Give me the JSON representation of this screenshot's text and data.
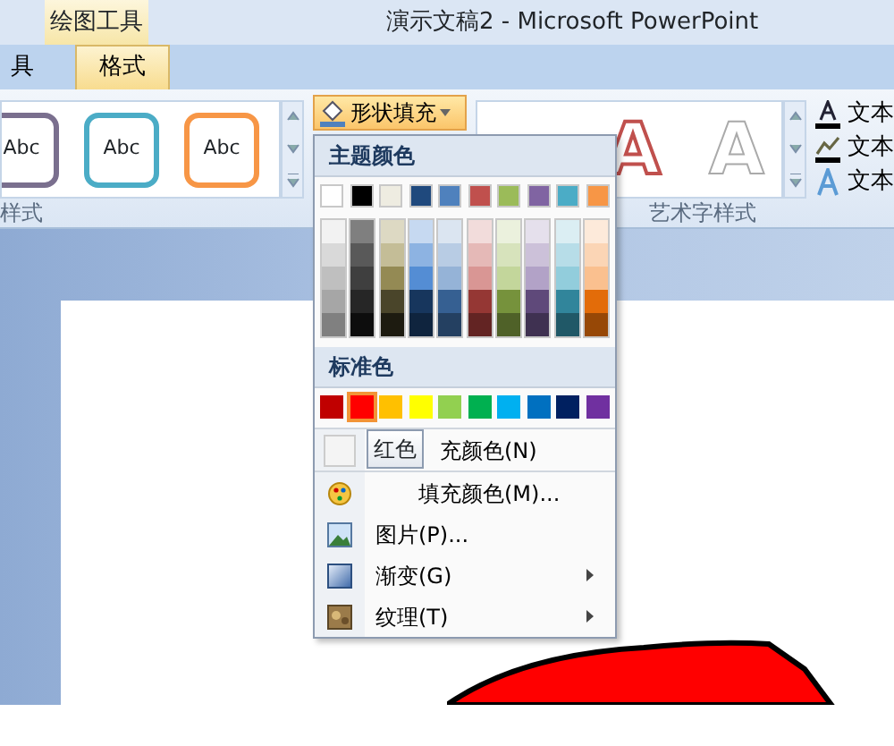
{
  "window": {
    "title": "演示文稿2 - Microsoft PowerPoint",
    "context_tab_group": "绘图工具"
  },
  "tabs": [
    {
      "label": "具",
      "selected": false
    },
    {
      "label": "格式",
      "selected": true
    }
  ],
  "shape_styles": {
    "label": "样式",
    "samples": [
      {
        "text": "Abc",
        "color": "#7a6f8e"
      },
      {
        "text": "Abc",
        "color": "#4bacc6"
      },
      {
        "text": "Abc",
        "color": "#f79646"
      }
    ]
  },
  "shape_fill_button": {
    "label": "形状填充",
    "open": true
  },
  "wordart_styles": {
    "label": "艺术字样式",
    "samples": [
      {
        "kind": "hidden"
      },
      {
        "text": "A",
        "kind": "red-outline"
      },
      {
        "text": "A",
        "kind": "white"
      }
    ],
    "buttons": [
      {
        "label": "文本",
        "kind": "fill"
      },
      {
        "label": "文本",
        "kind": "outline"
      },
      {
        "label": "文本",
        "kind": "effects"
      }
    ]
  },
  "fill_menu": {
    "theme_header": "主题颜色",
    "theme_colors": [
      {
        "shades": [
          {
            "color": "#ffffff"
          },
          {
            "color": "#f2f2f2"
          },
          {
            "color": "#d9d9d9"
          },
          {
            "color": "#bfbfbf"
          },
          {
            "color": "#a6a6a6"
          },
          {
            "color": "#808080"
          }
        ]
      },
      {
        "shades": [
          {
            "color": "#000000"
          },
          {
            "color": "#7f7f7f"
          },
          {
            "color": "#595959"
          },
          {
            "color": "#3f3f3f"
          },
          {
            "color": "#262626"
          },
          {
            "color": "#0d0d0d"
          }
        ]
      },
      {
        "shades": [
          {
            "color": "#eeece1"
          },
          {
            "color": "#ddd9c3"
          },
          {
            "color": "#c4bd97"
          },
          {
            "color": "#948a54"
          },
          {
            "color": "#4a452a"
          },
          {
            "color": "#1d1b10"
          }
        ]
      },
      {
        "shades": [
          {
            "color": "#1f497d"
          },
          {
            "color": "#c6d9f1"
          },
          {
            "color": "#8db3e2"
          },
          {
            "color": "#548dd4"
          },
          {
            "color": "#17365d"
          },
          {
            "color": "#0f243e"
          }
        ]
      },
      {
        "shades": [
          {
            "color": "#4f81bd"
          },
          {
            "color": "#dbe5f1"
          },
          {
            "color": "#b8cce4"
          },
          {
            "color": "#95b3d7"
          },
          {
            "color": "#366092"
          },
          {
            "color": "#244061"
          }
        ]
      },
      {
        "shades": [
          {
            "color": "#c0504d"
          },
          {
            "color": "#f2dcdb"
          },
          {
            "color": "#e5b9b7"
          },
          {
            "color": "#d99694"
          },
          {
            "color": "#953734"
          },
          {
            "color": "#632423"
          }
        ]
      },
      {
        "shades": [
          {
            "color": "#9bbb59"
          },
          {
            "color": "#ebf1dd"
          },
          {
            "color": "#d7e3bc"
          },
          {
            "color": "#c3d69b"
          },
          {
            "color": "#76923c"
          },
          {
            "color": "#4f6128"
          }
        ]
      },
      {
        "shades": [
          {
            "color": "#8064a2"
          },
          {
            "color": "#e5e0ec"
          },
          {
            "color": "#ccc1d9"
          },
          {
            "color": "#b2a2c7"
          },
          {
            "color": "#5f497a"
          },
          {
            "color": "#3f3151"
          }
        ]
      },
      {
        "shades": [
          {
            "color": "#4bacc6"
          },
          {
            "color": "#dbeef3"
          },
          {
            "color": "#b7dde8"
          },
          {
            "color": "#92cddc"
          },
          {
            "color": "#31859b"
          },
          {
            "color": "#205867"
          }
        ]
      },
      {
        "shades": [
          {
            "color": "#f79646"
          },
          {
            "color": "#fdeada"
          },
          {
            "color": "#fbd5b5"
          },
          {
            "color": "#fac08f"
          },
          {
            "color": "#e36c09"
          },
          {
            "color": "#974806"
          }
        ]
      }
    ],
    "standard_header": "标准色",
    "standard_colors": [
      {
        "color": "#c00000",
        "hovered": false
      },
      {
        "color": "#ff0000",
        "hovered": true
      },
      {
        "color": "#ffc000",
        "hovered": false
      },
      {
        "color": "#ffff00",
        "hovered": false
      },
      {
        "color": "#92d050",
        "hovered": false
      },
      {
        "color": "#00b050",
        "hovered": false
      },
      {
        "color": "#00b0f0",
        "hovered": false
      },
      {
        "color": "#0070c0",
        "hovered": false
      },
      {
        "color": "#002060",
        "hovered": false
      },
      {
        "color": "#7030a0",
        "hovered": false
      }
    ],
    "tooltip": "红色",
    "items": [
      {
        "label": "充颜色(N)",
        "kind": "no-fill",
        "submenu": false
      },
      {
        "label": "填充颜色(M)...",
        "kind": "more-colors",
        "submenu": false
      },
      {
        "label": "图片(P)...",
        "kind": "picture",
        "submenu": false
      },
      {
        "label": "渐变(G)",
        "kind": "gradient",
        "submenu": true
      },
      {
        "label": "纹理(T)",
        "kind": "texture",
        "submenu": true
      }
    ]
  }
}
